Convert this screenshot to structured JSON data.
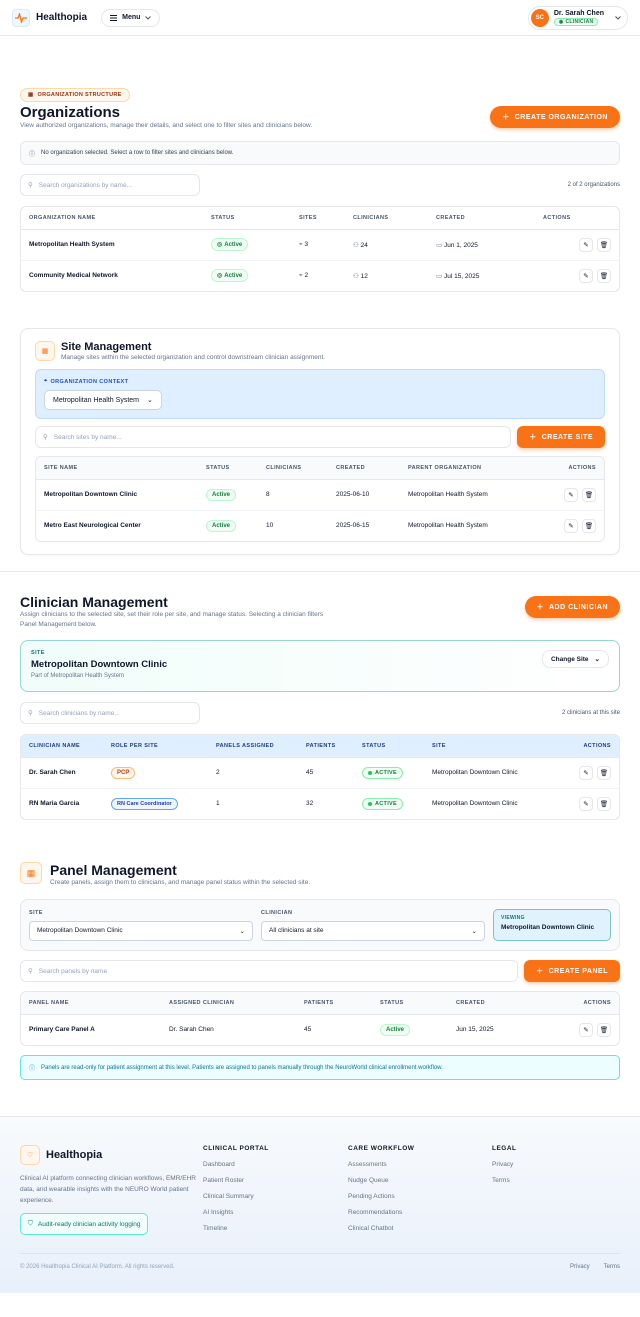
{
  "header": {
    "brand": "Healthopia",
    "menu": "Menu",
    "user_initials": "SC",
    "user_name": "Dr. Sarah Chen",
    "user_role": "CLINICIAN"
  },
  "orgs": {
    "chip": "ORGANIZATION STRUCTURE",
    "title": "Organizations",
    "desc": "View authorized organizations, manage their details, and select one to filter sites and clinicians below.",
    "create": "CREATE ORGANIZATION",
    "notice": "No organization selected. Select a row to filter sites and clinicians below.",
    "search_placeholder": "Search organizations by name...",
    "count": "2 of 2 organizations",
    "columns": [
      "ORGANIZATION NAME",
      "STATUS",
      "SITES",
      "CLINICIANS",
      "CREATED",
      "ACTIONS"
    ],
    "rows": [
      {
        "name": "Metropolitan Health System",
        "status": "Active",
        "sites": "3",
        "clinicians": "24",
        "created": "Jun 1, 2025"
      },
      {
        "name": "Community Medical Network",
        "status": "Active",
        "sites": "2",
        "clinicians": "12",
        "created": "Jul 15, 2025"
      }
    ]
  },
  "sites": {
    "title": "Site Management",
    "desc": "Manage sites within the selected organization and control downstream clinician assignment.",
    "ctx_label": "ORGANIZATION CONTEXT",
    "ctx_value": "Metropolitan Health System",
    "search_placeholder": "Search sites by name...",
    "create": "CREATE SITE",
    "columns": [
      "SITE NAME",
      "STATUS",
      "CLINICIANS",
      "CREATED",
      "PARENT ORGANIZATION",
      "ACTIONS"
    ],
    "rows": [
      {
        "name": "Metropolitan Downtown Clinic",
        "status": "Active",
        "clinicians": "8",
        "created": "2025-06-10",
        "parent": "Metropolitan Health System"
      },
      {
        "name": "Metro East Neurological Center",
        "status": "Active",
        "clinicians": "10",
        "created": "2025-06-15",
        "parent": "Metropolitan Health System"
      }
    ]
  },
  "clin": {
    "title": "Clinician Management",
    "desc": "Assign clinicians to the selected site, set their role per site, and manage status. Selecting a clinician filters Panel Management below.",
    "add": "ADD CLINICIAN",
    "site_label": "SITE",
    "site_name": "Metropolitan Downtown Clinic",
    "site_parent": "Part of Metropolitan Health System",
    "change_site": "Change Site",
    "search_placeholder": "Search clinicians by name...",
    "count": "2 clinicians at this site",
    "columns": [
      "CLINICIAN NAME",
      "ROLE PER SITE",
      "PANELS ASSIGNED",
      "PATIENTS",
      "STATUS",
      "SITE",
      "ACTIONS"
    ],
    "rows": [
      {
        "name": "Dr. Sarah Chen",
        "role": "PCP",
        "panels": "2",
        "patients": "45",
        "status": "ACTIVE",
        "site": "Metropolitan Downtown Clinic"
      },
      {
        "name": "RN Maria Garcia",
        "role": "RN Care Coordinator",
        "panels": "1",
        "patients": "32",
        "status": "ACTIVE",
        "site": "Metropolitan Downtown Clinic"
      }
    ]
  },
  "panel": {
    "title": "Panel Management",
    "desc": "Create panels, assign them to clinicians, and manage panel status within the selected site.",
    "site_label": "SITE",
    "site_value": "Metropolitan Downtown Clinic",
    "clin_label": "CLINICIAN",
    "clin_value": "All clinicians at site",
    "viewing_label": "VIEWING",
    "viewing_value": "Metropolitan Downtown Clinic",
    "search_placeholder": "Search panels by name",
    "create": "CREATE PANEL",
    "columns": [
      "PANEL NAME",
      "ASSIGNED CLINICIAN",
      "PATIENTS",
      "STATUS",
      "CREATED",
      "ACTIONS"
    ],
    "rows": [
      {
        "name": "Primary Care Panel A",
        "clinician": "Dr. Sarah Chen",
        "patients": "45",
        "status": "Active",
        "created": "Jun 15, 2025"
      }
    ],
    "info": "Panels are read-only for patient assignment at this level. Patients are assigned to panels manually through the NeuroWorld clinical enrollment workflow."
  },
  "footer": {
    "brand": "Healthopia",
    "desc": "Clinical AI platform connecting clinician workflows, EMR/EHR data, and wearable insights with the NEURO World patient experience.",
    "audit": "Audit-ready clinician activity logging",
    "portal_title": "CLINICAL PORTAL",
    "portal": [
      "Dashboard",
      "Patient Roster",
      "Clinical Summary",
      "AI Insights",
      "Timeline"
    ],
    "care_title": "CARE WORKFLOW",
    "care": [
      "Assessments",
      "Nudge Queue",
      "Pending Actions",
      "Recommendations",
      "Clinical Chatbot"
    ],
    "legal_title": "LEGAL",
    "legal": [
      "Privacy",
      "Terms"
    ],
    "copyright": "© 2026 Healthopia Clinical AI Platform. All rights reserved.",
    "privacy": "Privacy",
    "terms": "Terms"
  }
}
